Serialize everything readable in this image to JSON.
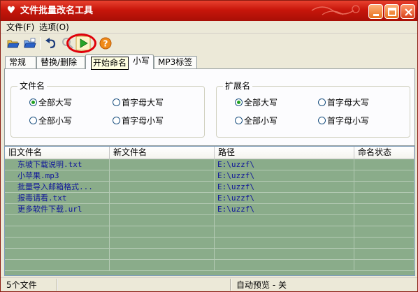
{
  "window": {
    "title": "文件批量改名工具",
    "app_icon": "heart-icon",
    "title_color": "#c8160b",
    "controls": [
      {
        "name": "minimize-button",
        "icon": "minimize-icon"
      },
      {
        "name": "maximize-button",
        "icon": "maximize-icon"
      },
      {
        "name": "close-button",
        "icon": "close-icon"
      }
    ]
  },
  "menu": {
    "file": "文件(F)",
    "options": "选项(O)"
  },
  "toolbar": {
    "tools": [
      {
        "name": "open-file-button",
        "icon": "open-folder-icon"
      },
      {
        "name": "open-folder-button",
        "icon": "open-folder-alt-icon"
      },
      {
        "name": "undo-button",
        "icon": "undo-icon"
      },
      {
        "name": "search-button",
        "icon": "search-icon"
      },
      {
        "name": "start-rename-button",
        "icon": "play-icon"
      },
      {
        "name": "help-button",
        "icon": "help-icon"
      }
    ],
    "tooltip": "开始命名",
    "highlight_color": "#e0000a"
  },
  "tabs": [
    {
      "label": "常规"
    },
    {
      "label": "替换/删除"
    },
    {
      "label": "小写"
    },
    {
      "label": "MP3标签"
    }
  ],
  "panel": {
    "filename_group": {
      "title": "文件名",
      "options": [
        {
          "label": "全部大写",
          "checked": true
        },
        {
          "label": "首字母大写",
          "checked": false
        },
        {
          "label": "全部小写",
          "checked": false
        },
        {
          "label": "首字母小写",
          "checked": false
        }
      ]
    },
    "extension_group": {
      "title": "扩展名",
      "options": [
        {
          "label": "全部大写",
          "checked": true
        },
        {
          "label": "首字母大写",
          "checked": false
        },
        {
          "label": "全部小写",
          "checked": false
        },
        {
          "label": "首字母小写",
          "checked": false
        }
      ]
    }
  },
  "table": {
    "columns": [
      "旧文件名",
      "新文件名",
      "路径",
      "命名状态"
    ],
    "rows": [
      {
        "old": "东坡下载说明.txt",
        "new": "",
        "path": "E:\\uzzf\\",
        "status": ""
      },
      {
        "old": "小苹果.mp3",
        "new": "",
        "path": "E:\\uzzf\\",
        "status": ""
      },
      {
        "old": "批量导入邮箱格式...",
        "new": "",
        "path": "E:\\uzzf\\",
        "status": ""
      },
      {
        "old": "报毒请看.txt",
        "new": "",
        "path": "E:\\uzzf\\",
        "status": ""
      },
      {
        "old": "更多软件下载.url",
        "new": "",
        "path": "E:\\uzzf\\",
        "status": ""
      }
    ],
    "row_bg": "#8aac8a",
    "text_color": "#10169a"
  },
  "status": {
    "count": "5个文件",
    "preview": "自动预览 - 关"
  }
}
